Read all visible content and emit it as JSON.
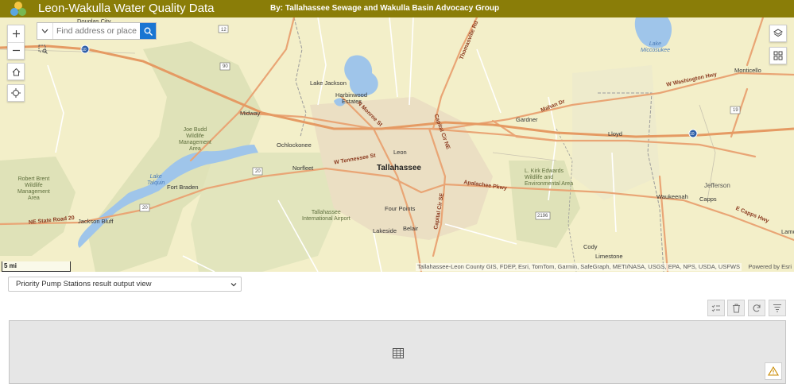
{
  "header": {
    "title": "Leon-Wakulla Water Quality Data",
    "subtitle": "By: Tallahassee Sewage and Wakulla Basin Advocacy Group",
    "background": "#8a7d08"
  },
  "search": {
    "placeholder": "Find address or place"
  },
  "map": {
    "scale_label": "5 mi",
    "attribution": "Tallahassee-Leon County GIS, FDEP, Esri, TomTom, Garmin, SafeGraph, METI/NASA, USGS, EPA, NPS, USDA, USFWS",
    "powered_by": "Powered by Esri",
    "labels": {
      "douglas_city": "Douglas City",
      "lake_jackson": "Lake Jackson",
      "harbinwood": "Harbinwood",
      "estates": "Estates",
      "midway": "Midway",
      "joe_budd": "Joe Budd\nWildlife\nManagement\nArea",
      "ochlockonee": "Ochlockonee",
      "norfleet": "Norfleet",
      "leon": "Leon",
      "tallahassee": "Tallahassee",
      "robert_brent": "Robert Brent\nWildlife\nManagement\nArea",
      "lake_talquin": "Lake\nTalquin",
      "fort_braden": "Fort Braden",
      "jackson_bluff": "Jackson Bluff",
      "tlh_airport": "Tallahassee\nInternational Airport",
      "four_points": "Four Points",
      "lakeside": "Lakeside",
      "belair": "Belair",
      "gardner": "Gardner",
      "lloyd": "Lloyd",
      "kirk_edwards": "L. Kirk Edwards\nWildlife and\nEnvironmental Area",
      "waukeenah": "Waukeenah",
      "capps": "Capps",
      "jefferson": "Jefferson",
      "monticello": "Monticello",
      "lake_miccosukee": "Lake\nMiccosukee",
      "cody": "Cody",
      "limestone": "Limestone",
      "lamont": "Lamo",
      "w_washington_hwy": "W Washington Hwy",
      "mahan_dr": "Mahan Dr",
      "apalachee_pkwy": "Apalachee Pkwy",
      "e_capps_hwy": "E Capps Hwy",
      "w_tennessee_st": "W Tennessee St",
      "capital_cir_ne": "Capital Cir NE",
      "capital_cir_se": "Capital Cir SE",
      "thomasville_rd": "Thomasville Rd",
      "n_monroe_st": "N Monroe St",
      "ne_state_road_20": "NE State Road 20",
      "hwy_12": "12",
      "hwy_90": "90",
      "hwy_20a": "20",
      "hwy_20b": "20",
      "hwy_19": "19",
      "hwy_2196": "2196",
      "i10_w": "10",
      "i10_e": "10"
    }
  },
  "table": {
    "layer_select": "Priority Pump Stations result output view",
    "toolbar": [
      "select-all",
      "delete",
      "refresh",
      "show-columns"
    ]
  },
  "colors": {
    "primary_road": "#e8a06e",
    "water": "#a6c8ec",
    "park": "#d9ddb1",
    "urban": "#e8ddc0",
    "accent": "#1a75d2"
  }
}
